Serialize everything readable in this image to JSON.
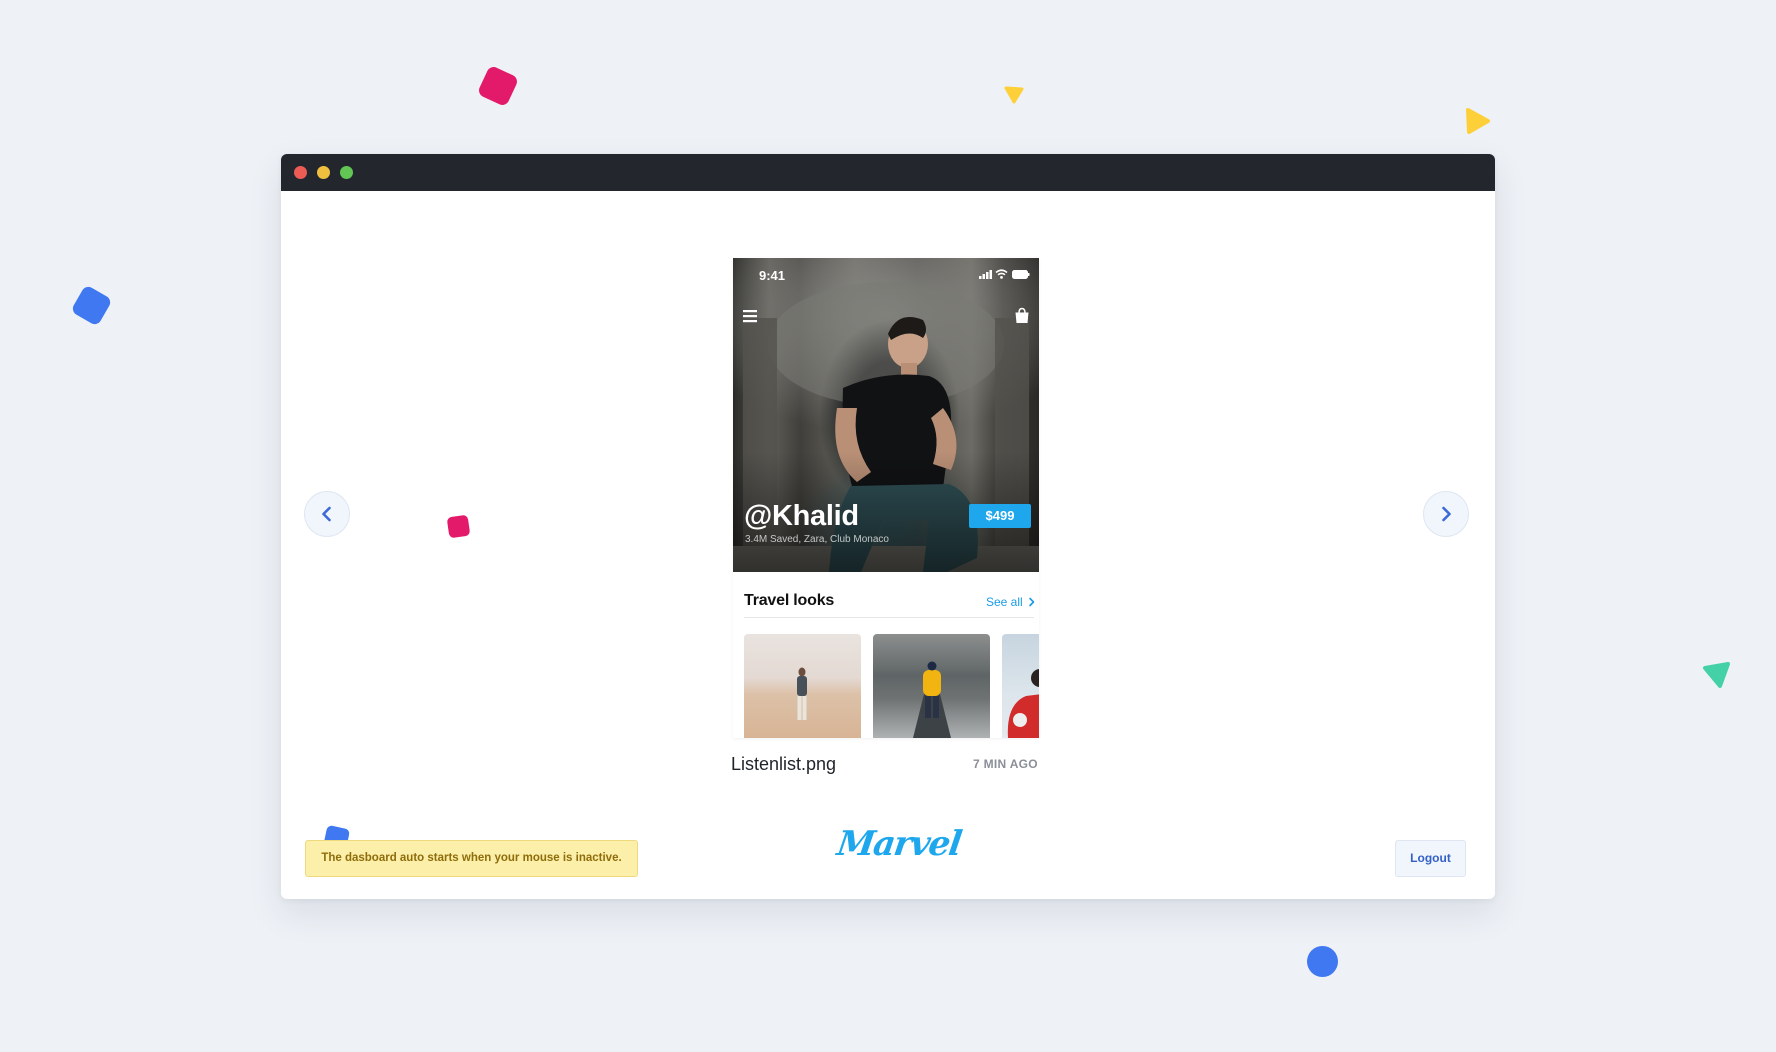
{
  "window": {
    "traffic_lights": {
      "close_color": "#ec5c55",
      "minimize_color": "#f1bf3f",
      "maximize_color": "#62c655"
    }
  },
  "navigation": {
    "prev_icon": "chevron-left-icon",
    "next_icon": "chevron-right-icon",
    "accent_color": "#3a6bd8"
  },
  "preview": {
    "status_bar": {
      "time": "9:41",
      "icons": [
        "signal-icon",
        "wifi-icon",
        "battery-icon"
      ]
    },
    "header_icons": [
      "menu-icon",
      "shopping-bag-icon"
    ],
    "profile": {
      "handle": "@Khalid",
      "subtitle": "3.4M Saved, Zara, Club Monaco",
      "price": "$499"
    },
    "section": {
      "title": "Travel looks",
      "see_all": "See all",
      "see_all_icon": "chevron-right-icon"
    },
    "thumbnails": [
      "desert-look-image",
      "snow-road-look-image",
      "red-car-look-image"
    ]
  },
  "file": {
    "name": "Listenlist.png",
    "time": "7 MIN AGO"
  },
  "footer": {
    "notice": "The dasboard auto starts when your mouse is inactive.",
    "logo": "Marvel",
    "logout": "Logout"
  },
  "colors": {
    "background": "#eef1f6",
    "accent_blue": "#1fa7ee",
    "confetti": [
      "#e31a6a",
      "#fdd03a",
      "#3f78f1",
      "#45d1a7"
    ]
  }
}
